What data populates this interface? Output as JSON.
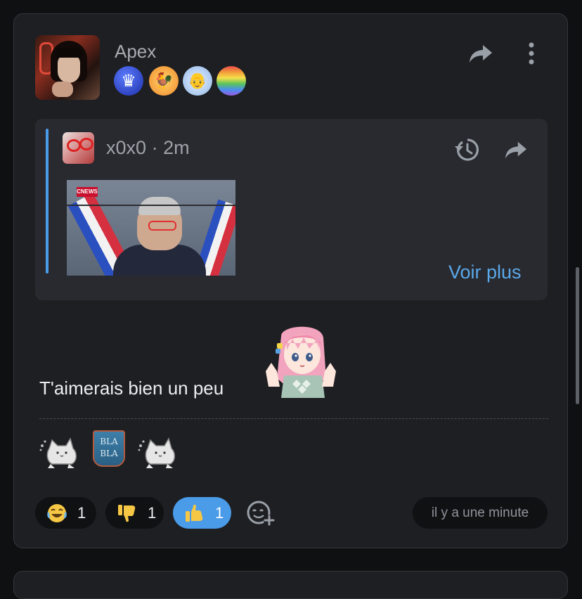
{
  "post": {
    "author": {
      "username": "Apex",
      "avatar_icon": "avatar-icon"
    },
    "badges": [
      {
        "name": "crown-badge-icon",
        "glyph": "♛"
      },
      {
        "name": "chicken-badge-icon",
        "glyph": "🐓"
      },
      {
        "name": "meme-face-badge-icon",
        "glyph": "👴"
      },
      {
        "name": "rainbow-badge-icon",
        "glyph": ""
      }
    ],
    "quote": {
      "author": "x0x0",
      "separator": "·",
      "time": "2m",
      "more_label": "Voir plus",
      "media_logo": "CNEWS"
    },
    "message": "T'aimerais bien un peu",
    "emotes": [
      "cat-emote",
      "bla-bla-emote",
      "cat-emote"
    ],
    "blabla_text": "BLA BLA",
    "reactions": [
      {
        "emoji": "laughing-face",
        "count": "1",
        "selected": false
      },
      {
        "emoji": "thumbs-down",
        "count": "1",
        "selected": false
      },
      {
        "emoji": "thumbs-up",
        "count": "1",
        "selected": true
      }
    ],
    "timestamp": "il y a une minute"
  },
  "colors": {
    "background": "#0f1012",
    "card": "#1e1f22",
    "quote_bg": "#282a2f",
    "accent": "#4a9be8",
    "link": "#5ba8ea",
    "muted_text": "#a7abb2"
  }
}
